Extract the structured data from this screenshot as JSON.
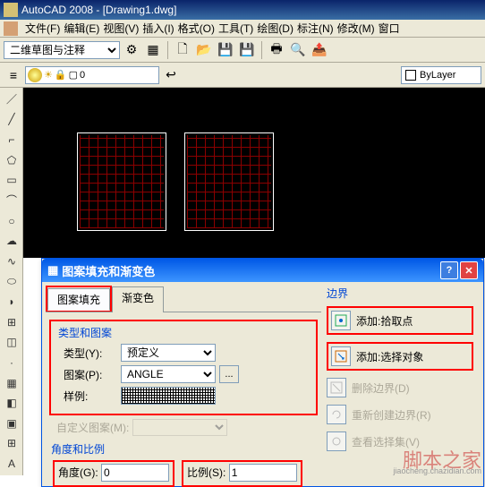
{
  "title": "AutoCAD 2008 - [Drawing1.dwg]",
  "menu": [
    "文件(F)",
    "编辑(E)",
    "视图(V)",
    "插入(I)",
    "格式(O)",
    "工具(T)",
    "绘图(D)",
    "标注(N)",
    "修改(M)",
    "窗口"
  ],
  "workspace_dd": "二维草图与注释",
  "layer_name": "0",
  "bylayer": "ByLayer",
  "dialog": {
    "title": "图案填充和渐变色",
    "tabs": [
      "图案填充",
      "渐变色"
    ],
    "group_type": "类型和图案",
    "lbl_type": "类型(Y):",
    "val_type": "预定义",
    "lbl_pattern": "图案(P):",
    "val_pattern": "ANGLE",
    "lbl_sample": "样例:",
    "custom_disabled": "自定义图案(M):",
    "group_angle": "角度和比例",
    "lbl_angle": "角度(G):",
    "val_angle": "0",
    "lbl_scale": "比例(S):",
    "val_scale": "1",
    "boundary_label": "边界",
    "add_pick": "添加:拾取点",
    "add_select": "添加:选择对象",
    "del_boundary": "删除边界(D)",
    "recreate": "重新创建边界(R)",
    "view_sel": "查看选择集(V)"
  },
  "watermark": "脚本之家",
  "watermark_url": "jiaocheng.chazidian.com"
}
